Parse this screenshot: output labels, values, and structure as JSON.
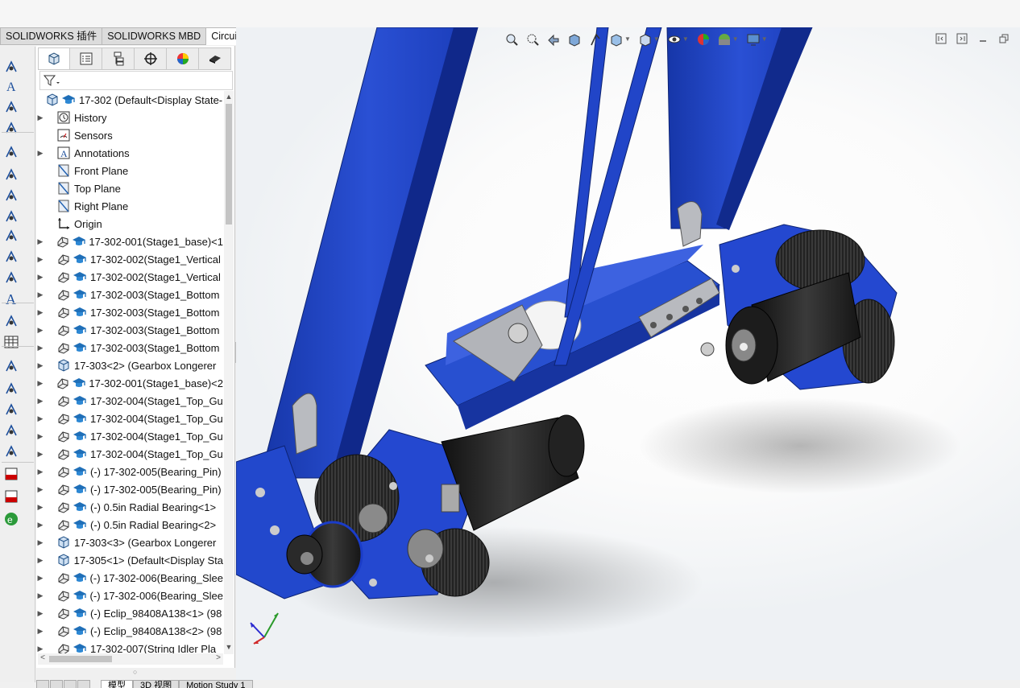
{
  "ribbon_tabs": [
    {
      "label": "SOLIDWORKS 插件",
      "active": false
    },
    {
      "label": "SOLIDWORKS MBD",
      "active": false
    },
    {
      "label": "CircuitWorks",
      "active": true
    }
  ],
  "left_toolbar_icons": [
    "smart-dimension-icon",
    "note-icon",
    "balloon-icon",
    "auto-balloon-icon",
    "bom-icon",
    "magnetic-line-icon",
    "datum-feature-icon",
    "datum-target-icon",
    "geometric-tolerance-icon",
    "surface-finish-icon",
    "weld-symbol-icon",
    "text-icon",
    "hole-callout-icon",
    "table-icon",
    "3d-view-icon",
    "section-view-icon",
    "explode-view-icon",
    "assembly-visualization-icon",
    "drawing-icon",
    "3d-pdf-icon",
    "3d-pdf-export-icon",
    "edrawings-icon"
  ],
  "feature_manager": {
    "tabs": [
      "featuremanager-tab",
      "propertymanager-tab",
      "configurationmanager-tab",
      "dimxpertmanager-tab",
      "displaymanager-tab",
      "cam-tab"
    ],
    "root_label": "17-302  (Default<Display State-",
    "items": [
      {
        "label": "History",
        "icon": "history-icon",
        "expandable": true
      },
      {
        "label": "Sensors",
        "icon": "sensors-icon",
        "expandable": false
      },
      {
        "label": "Annotations",
        "icon": "annotations-icon",
        "expandable": true
      },
      {
        "label": "Front Plane",
        "icon": "plane-icon",
        "expandable": false
      },
      {
        "label": "Top Plane",
        "icon": "plane-icon",
        "expandable": false
      },
      {
        "label": "Right Plane",
        "icon": "plane-icon",
        "expandable": false
      },
      {
        "label": "Origin",
        "icon": "origin-icon",
        "expandable": false
      },
      {
        "label": "17-302-001(Stage1_base)<1",
        "icon": "part-icon",
        "expandable": true
      },
      {
        "label": "17-302-002(Stage1_Vertical",
        "icon": "part-icon",
        "expandable": true
      },
      {
        "label": "17-302-002(Stage1_Vertical",
        "icon": "part-icon",
        "expandable": true
      },
      {
        "label": "17-302-003(Stage1_Bottom",
        "icon": "part-icon",
        "expandable": true
      },
      {
        "label": "17-302-003(Stage1_Bottom",
        "icon": "part-icon",
        "expandable": true
      },
      {
        "label": "17-302-003(Stage1_Bottom",
        "icon": "part-icon",
        "expandable": true
      },
      {
        "label": "17-302-003(Stage1_Bottom",
        "icon": "part-icon",
        "expandable": true
      },
      {
        "label": "17-303<2> (Gearbox Longerer",
        "icon": "assembly-icon",
        "expandable": true
      },
      {
        "label": "17-302-001(Stage1_base)<2",
        "icon": "part-icon",
        "expandable": true
      },
      {
        "label": "17-302-004(Stage1_Top_Gu",
        "icon": "part-icon",
        "expandable": true
      },
      {
        "label": "17-302-004(Stage1_Top_Gu",
        "icon": "part-icon",
        "expandable": true
      },
      {
        "label": "17-302-004(Stage1_Top_Gu",
        "icon": "part-icon",
        "expandable": true
      },
      {
        "label": "17-302-004(Stage1_Top_Gu",
        "icon": "part-icon",
        "expandable": true
      },
      {
        "label": "(-) 17-302-005(Bearing_Pin)",
        "icon": "part-icon",
        "expandable": true
      },
      {
        "label": "(-) 17-302-005(Bearing_Pin)",
        "icon": "part-icon",
        "expandable": true
      },
      {
        "label": "(-) 0.5in Radial Bearing<1>",
        "icon": "part-icon",
        "expandable": true
      },
      {
        "label": "(-) 0.5in Radial Bearing<2>",
        "icon": "part-icon",
        "expandable": true
      },
      {
        "label": "17-303<3> (Gearbox Longerer",
        "icon": "assembly-icon",
        "expandable": true
      },
      {
        "label": "17-305<1> (Default<Display Sta",
        "icon": "assembly-icon",
        "expandable": true
      },
      {
        "label": "(-) 17-302-006(Bearing_Slee",
        "icon": "part-icon",
        "expandable": true
      },
      {
        "label": "(-) 17-302-006(Bearing_Slee",
        "icon": "part-icon",
        "expandable": true
      },
      {
        "label": "(-) Eclip_98408A138<1> (98",
        "icon": "part-icon",
        "expandable": true
      },
      {
        "label": "(-) Eclip_98408A138<2> (98",
        "icon": "part-icon",
        "expandable": true
      },
      {
        "label": "17-302-007(String Idler Pla",
        "icon": "part-icon",
        "expandable": true
      }
    ]
  },
  "bottom_tabs": [
    {
      "label": "模型",
      "active": true
    },
    {
      "label": "3D 视图",
      "active": false
    },
    {
      "label": "Motion Study 1",
      "active": false
    }
  ],
  "heads_up_toolbar": [
    "zoom-to-fit-icon",
    "zoom-to-area-icon",
    "previous-view-icon",
    "section-view-icon",
    "dynamic-annotation-icon",
    "view-orientation-icon",
    "display-style-icon",
    "hide-show-items-icon",
    "edit-appearance-icon",
    "apply-scene-icon",
    "view-settings-icon"
  ],
  "colors": {
    "model_blue": "#1b3fc0",
    "model_blue_light": "#3058d8",
    "gear_dark": "#2b2b2b",
    "bracket_grey": "#b4b6bb"
  }
}
